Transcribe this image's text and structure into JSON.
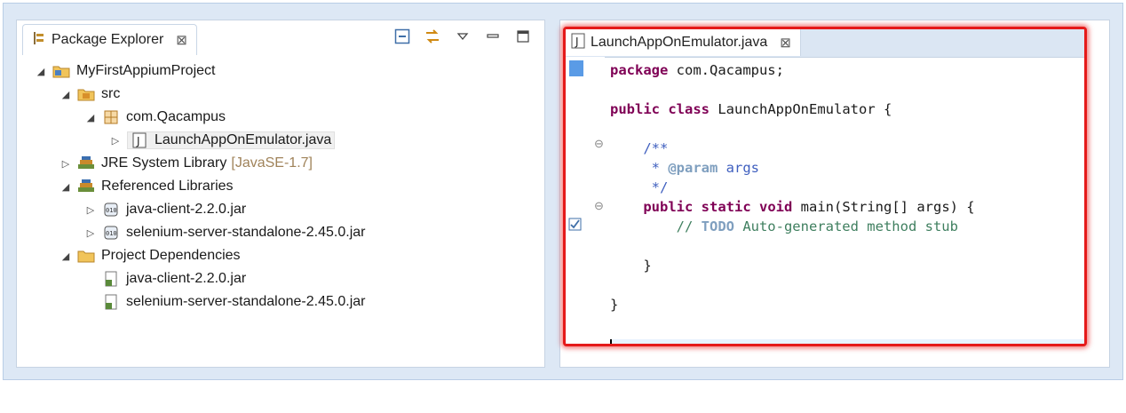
{
  "package_explorer": {
    "tab_label": "Package Explorer",
    "tab_close": "⊠",
    "toolbar": [
      "collapse-all-icon",
      "link-with-editor-icon",
      "view-menu-icon",
      "minimize-icon",
      "maximize-icon"
    ],
    "tree": [
      {
        "label": "MyFirstAppiumProject",
        "twisty": "◢",
        "icon": "project-icon"
      },
      {
        "label": "src",
        "twisty": "◢",
        "icon": "source-folder-icon"
      },
      {
        "label": "com.Qacampus",
        "twisty": "◢",
        "icon": "package-icon"
      },
      {
        "label": "LaunchAppOnEmulator.java",
        "twisty": "▷",
        "icon": "java-file-icon"
      },
      {
        "label": "JRE System Library",
        "suffix": "[JavaSE-1.7]",
        "twisty": "▷",
        "icon": "library-icon"
      },
      {
        "label": "Referenced Libraries",
        "twisty": "◢",
        "icon": "library-icon"
      },
      {
        "label": "java-client-2.2.0.jar",
        "twisty": "▷",
        "icon": "jar-icon"
      },
      {
        "label": "selenium-server-standalone-2.45.0.jar",
        "twisty": "▷",
        "icon": "jar-icon"
      },
      {
        "label": "Project Dependencies",
        "twisty": "◢",
        "icon": "folder-icon"
      },
      {
        "label": "java-client-2.2.0.jar",
        "icon": "jar-dependency-icon"
      },
      {
        "label": "selenium-server-standalone-2.45.0.jar",
        "icon": "jar-dependency-icon"
      }
    ]
  },
  "editor": {
    "tab_label": "LaunchAppOnEmulator.java",
    "tab_close": "⊠",
    "code": {
      "l1_kw": "package",
      "l1_rest": " com.Qacampus;",
      "l2_kw1": "public",
      "l2_kw2": "class",
      "l2_rest": " LaunchAppOnEmulator {",
      "l3": "    /**",
      "l4_star": "     * ",
      "l4_tag": "@param",
      "l4_rest": " args",
      "l5": "     */",
      "l6_kw1": "public",
      "l6_kw2": "static",
      "l6_kw3": "void",
      "l6_rest": " main(String[] args) {",
      "l7_pre": "        // ",
      "l7_todo": "TODO",
      "l7_rest": " Auto-generated method stub",
      "l8": "    }",
      "l9": "}"
    },
    "gutter_fold": "⊖"
  }
}
